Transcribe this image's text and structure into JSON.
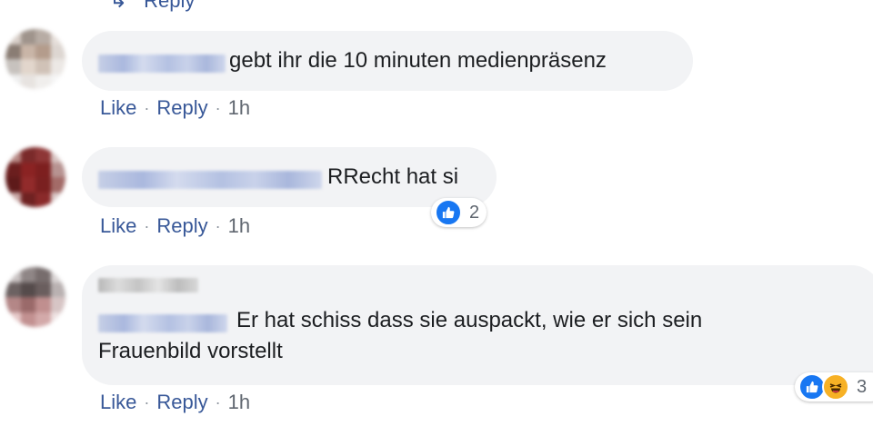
{
  "top_partial": {
    "reply_label": "Reply"
  },
  "comments": [
    {
      "text": "gebt ihr die 10 minuten medienpräsenz",
      "actions": {
        "like": "Like",
        "reply": "Reply",
        "time": "1h"
      }
    },
    {
      "text": "RRecht hat si",
      "reaction_count": "2",
      "actions": {
        "like": "Like",
        "reply": "Reply",
        "time": "1h"
      }
    },
    {
      "text_line1": "Er hat schiss dass sie auspackt, wie er sich sein",
      "text_line2": "Frauenbild vorstellt",
      "reaction_count": "3",
      "actions": {
        "like": "Like",
        "reply": "Reply",
        "time": "1h"
      }
    }
  ],
  "colors": {
    "bubble": "#f2f3f5",
    "link": "#385898",
    "meta": "#606770",
    "like_blue": "#1877f2",
    "haha_yellow": "#f7b125"
  },
  "icons": [
    "reply-arrow-icon",
    "like-reaction-icon",
    "haha-reaction-icon"
  ]
}
